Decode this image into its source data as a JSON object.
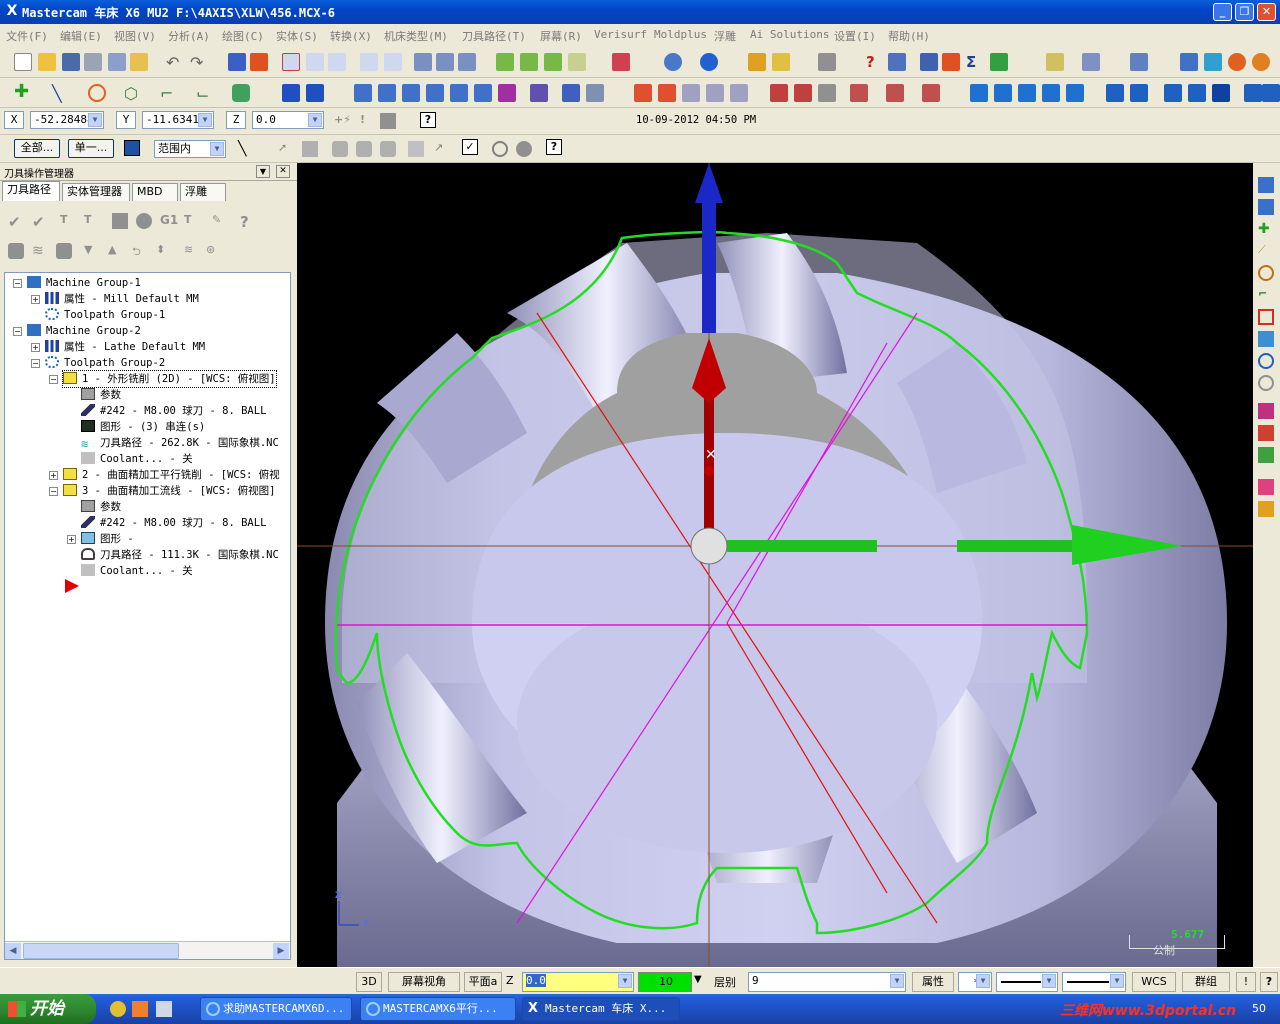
{
  "window": {
    "title": "Mastercam 车床 X6 MU2  F:\\4AXIS\\XLW\\456.MCX-6",
    "app_icon": "X"
  },
  "menu": [
    "文件(F)",
    "编辑(E)",
    "视图(V)",
    "分析(A)",
    "绘图(C)",
    "实体(S)",
    "转换(X)",
    "机床类型(M)",
    "刀具路径(T)",
    "屏幕(R)",
    "Verisurf",
    "Moldplus",
    "浮雕",
    "Ai Solutions",
    "设置(I)",
    "帮助(H)"
  ],
  "coords": {
    "x_label": "X",
    "x_value": "-52.28488",
    "y_label": "Y",
    "y_value": "-11.63411",
    "z_label": "Z",
    "z_value": "0.0",
    "datetime": "10-09-2012 04:50 PM"
  },
  "selectbar": {
    "all_button": "全部...",
    "single_button": "单一...",
    "range_select": "范围内"
  },
  "panel": {
    "title": "刀具操作管理器",
    "tabs": [
      "刀具路径",
      "实体管理器",
      "MBD",
      "浮雕"
    ]
  },
  "tree": [
    {
      "text": "Machine Group-1",
      "icon": "machine-group-icon"
    },
    {
      "text": "属性 - Mill Default MM",
      "icon": "properties-icon"
    },
    {
      "text": "Toolpath Group-1",
      "icon": "toolpath-group-icon"
    },
    {
      "text": "Machine Group-2",
      "icon": "machine-group-icon"
    },
    {
      "text": "属性 - Lathe Default MM",
      "icon": "properties-icon"
    },
    {
      "text": "Toolpath Group-2",
      "icon": "toolpath-group-icon"
    },
    {
      "text": "1 - 外形铣削 (2D) - [WCS: 俯视图]",
      "icon": "folder-open-icon"
    },
    {
      "text": "参数",
      "icon": "parameters-icon"
    },
    {
      "text": "#242 - M8.00 球刀 -   8. BALL",
      "icon": "tool-icon"
    },
    {
      "text": "图形 - (3) 串连(s)",
      "icon": "geometry-icon"
    },
    {
      "text": "刀具路径 - 262.8K - 国际象棋.NC",
      "icon": "toolpath-icon"
    },
    {
      "text": "Coolant... - 关",
      "icon": "coolant-icon"
    },
    {
      "text": "2 - 曲面精加工平行铣削 - [WCS: 俯视",
      "icon": "folder-icon"
    },
    {
      "text": "3 - 曲面精加工流线 - [WCS: 俯视图]",
      "icon": "folder-open-icon"
    },
    {
      "text": "参数",
      "icon": "parameters-icon"
    },
    {
      "text": "#242 - M8.00 球刀 -   8. BALL",
      "icon": "tool-icon"
    },
    {
      "text": "图形 -",
      "icon": "geometry-icon"
    },
    {
      "text": "刀具路径 - 111.3K - 国际象棋.NC",
      "icon": "toolpath-locked-icon"
    },
    {
      "text": "Coolant... - 关",
      "icon": "coolant-icon"
    }
  ],
  "viewport": {
    "scale_value": "5.677",
    "scale_unit": "公制",
    "axis_z": "Z",
    "axis_y": "Y",
    "background": "#000000",
    "part_color": "#c8c8e8",
    "edge_color": "#22dd22"
  },
  "statusbar": {
    "view3d": "3D",
    "screen_view": "屏幕视角",
    "plane": "平面a",
    "z_label": "Z",
    "z_value": "0.0",
    "color_value": "10",
    "level_label": "层别",
    "level_value": "9",
    "attributes": "属性",
    "wcs": "WCS",
    "group": "群组",
    "excl": "!"
  },
  "taskbar": {
    "start": "开始",
    "tasks": [
      "求助MASTERCAMX6D...",
      "MASTERCAMX6平行...",
      "Mastercam 车床 X..."
    ],
    "watermark": "三维网www.3dportal.cn",
    "clock": "50"
  }
}
